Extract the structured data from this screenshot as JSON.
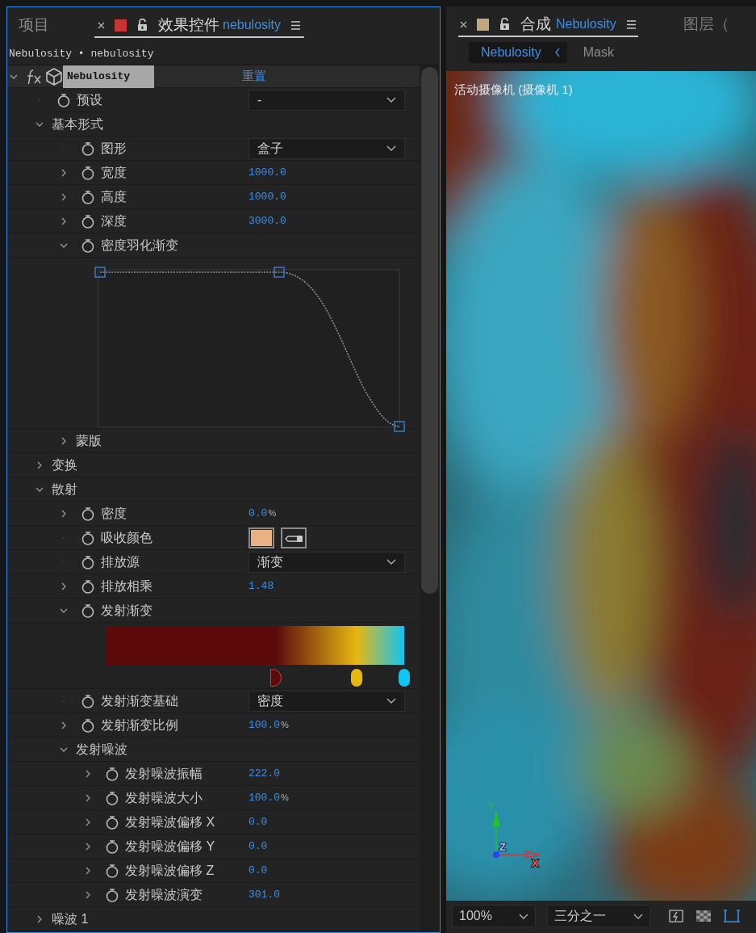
{
  "effects_panel": {
    "tabs": [
      {
        "label": "项目",
        "selected": false
      },
      {
        "label": "效果控件",
        "subject": "nebulosity",
        "color": "#c83535",
        "selected": true
      }
    ],
    "breadcrumb": "Nebulosity • nebulosity",
    "effect": {
      "name": "Nebulosity",
      "selected": true,
      "expanded": true,
      "reset_label": "重置",
      "children": [
        {
          "kind": "dropdown",
          "label": "预设",
          "value": "-"
        },
        {
          "kind": "group",
          "label": "基本形式",
          "expanded": true,
          "children": [
            {
              "kind": "dropdown",
              "label": "图形",
              "value": "盒子"
            },
            {
              "kind": "number",
              "label": "宽度",
              "expanded": false,
              "value": "1000.0"
            },
            {
              "kind": "number",
              "label": "高度",
              "expanded": false,
              "value": "1000.0"
            },
            {
              "kind": "number",
              "label": "深度",
              "expanded": false,
              "value": "3000.0"
            },
            {
              "kind": "curve",
              "label": "密度羽化渐变",
              "expanded": true
            },
            {
              "kind": "group",
              "label": "蒙版",
              "expanded": false
            }
          ]
        },
        {
          "kind": "group",
          "label": "变换",
          "expanded": false
        },
        {
          "kind": "group",
          "label": "散射",
          "expanded": true,
          "children": [
            {
              "kind": "number",
              "label": "密度",
              "expanded": false,
              "value": "0.0",
              "unit": "%"
            },
            {
              "kind": "color",
              "label": "吸收颜色",
              "color": "#e8b283"
            },
            {
              "kind": "dropdown",
              "label": "排放源",
              "value": "渐变"
            },
            {
              "kind": "number",
              "label": "排放相乘",
              "expanded": false,
              "value": "1.48"
            },
            {
              "kind": "gradient",
              "label": "发射渐变",
              "expanded": true,
              "stops": [
                {
                  "color": "#5c0a0a",
                  "level": 0.57,
                  "selected": true
                },
                {
                  "color": "#e6b812",
                  "level": 0.84,
                  "selected": false
                },
                {
                  "color": "#12c4f2",
                  "level": 1,
                  "selected": false
                }
              ]
            },
            {
              "kind": "dropdown",
              "label": "发射渐变基础",
              "value": "密度"
            },
            {
              "kind": "number",
              "label": "发射渐变比例",
              "expanded": false,
              "value": "100.0",
              "unit": "%"
            },
            {
              "kind": "group",
              "label": "发射噪波",
              "expanded": true,
              "children": [
                {
                  "kind": "number",
                  "label": "发射噪波振幅",
                  "expanded": false,
                  "value": "222.0"
                },
                {
                  "kind": "number",
                  "label": "发射噪波大小",
                  "expanded": false,
                  "value": "100.0",
                  "unit": "%"
                },
                {
                  "kind": "number",
                  "label": "发射噪波偏移 X",
                  "expanded": false,
                  "value": "0.0"
                },
                {
                  "kind": "number",
                  "label": "发射噪波偏移 Y",
                  "expanded": false,
                  "value": "0.0"
                },
                {
                  "kind": "number",
                  "label": "发射噪波偏移 Z",
                  "expanded": false,
                  "value": "0.0"
                },
                {
                  "kind": "number",
                  "label": "发射噪波演变",
                  "expanded": false,
                  "value": "301.0"
                }
              ]
            }
          ]
        },
        {
          "kind": "group",
          "label": "噪波 1",
          "expanded": false
        }
      ]
    }
  },
  "composition_panel": {
    "tabs": [
      {
        "label": "合成",
        "subject": "Nebulosity",
        "color": "#c0a880",
        "selected": true
      },
      {
        "label": "图层（",
        "selected": false
      }
    ],
    "layers": [
      {
        "label": "Nebulosity",
        "selected": true
      },
      {
        "label": "Mask",
        "selected": false
      }
    ],
    "camera_label": "活动摄像机 (摄像机 1)",
    "gizmo_labels": [
      "Y",
      "Z",
      "X"
    ],
    "zoom": "100%",
    "resolution": "三分之一"
  }
}
